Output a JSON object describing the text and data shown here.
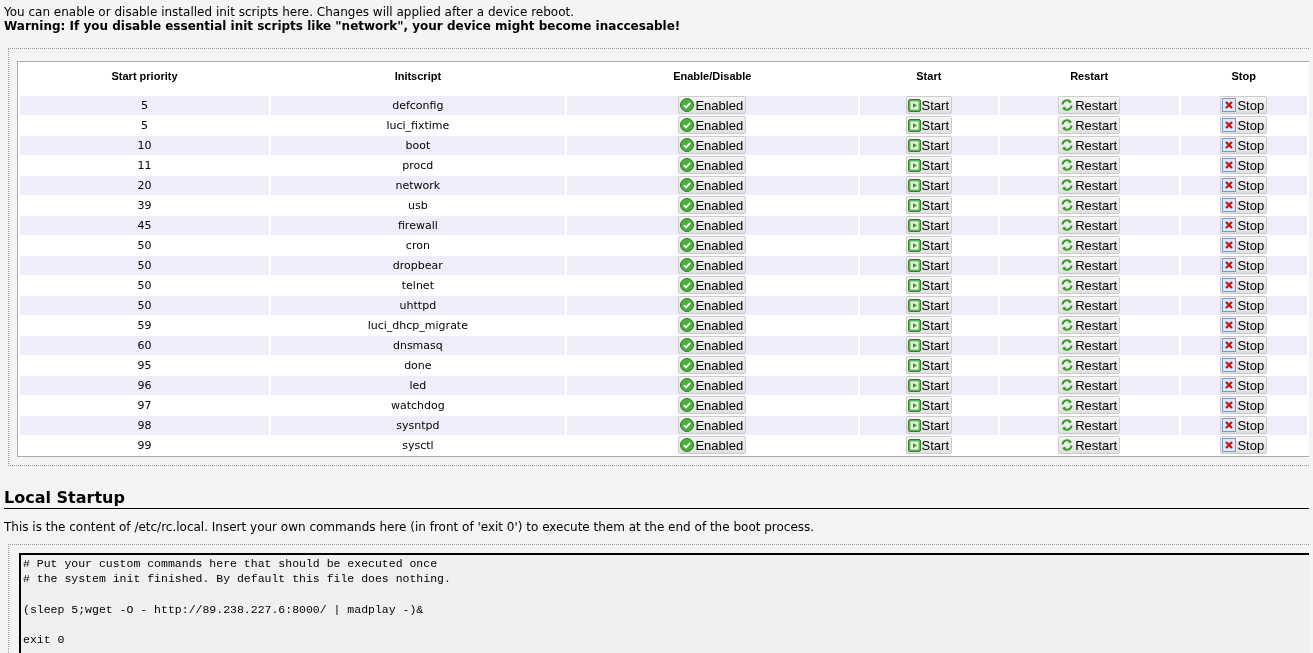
{
  "intro": "You can enable or disable installed init scripts here. Changes will applied after a device reboot.",
  "warning": "Warning: If you disable essential init scripts like \"network\", your device might become inaccesable!",
  "table": {
    "columns": [
      "Start priority",
      "Initscript",
      "Enable/Disable",
      "Start",
      "Restart",
      "Stop"
    ],
    "rows": [
      {
        "priority": "5",
        "name": "defconfig",
        "enabled": true,
        "toggle": "Enabled",
        "start": "Start",
        "restart": "Restart",
        "stop": "Stop"
      },
      {
        "priority": "5",
        "name": "luci_fixtime",
        "enabled": true,
        "toggle": "Enabled",
        "start": "Start",
        "restart": "Restart",
        "stop": "Stop"
      },
      {
        "priority": "10",
        "name": "boot",
        "enabled": true,
        "toggle": "Enabled",
        "start": "Start",
        "restart": "Restart",
        "stop": "Stop"
      },
      {
        "priority": "11",
        "name": "procd",
        "enabled": true,
        "toggle": "Enabled",
        "start": "Start",
        "restart": "Restart",
        "stop": "Stop"
      },
      {
        "priority": "20",
        "name": "network",
        "enabled": true,
        "toggle": "Enabled",
        "start": "Start",
        "restart": "Restart",
        "stop": "Stop"
      },
      {
        "priority": "39",
        "name": "usb",
        "enabled": true,
        "toggle": "Enabled",
        "start": "Start",
        "restart": "Restart",
        "stop": "Stop"
      },
      {
        "priority": "45",
        "name": "firewall",
        "enabled": true,
        "toggle": "Enabled",
        "start": "Start",
        "restart": "Restart",
        "stop": "Stop"
      },
      {
        "priority": "50",
        "name": "cron",
        "enabled": true,
        "toggle": "Enabled",
        "start": "Start",
        "restart": "Restart",
        "stop": "Stop"
      },
      {
        "priority": "50",
        "name": "dropbear",
        "enabled": true,
        "toggle": "Enabled",
        "start": "Start",
        "restart": "Restart",
        "stop": "Stop"
      },
      {
        "priority": "50",
        "name": "telnet",
        "enabled": true,
        "toggle": "Enabled",
        "start": "Start",
        "restart": "Restart",
        "stop": "Stop"
      },
      {
        "priority": "50",
        "name": "uhttpd",
        "enabled": true,
        "toggle": "Enabled",
        "start": "Start",
        "restart": "Restart",
        "stop": "Stop"
      },
      {
        "priority": "59",
        "name": "luci_dhcp_migrate",
        "enabled": true,
        "toggle": "Enabled",
        "start": "Start",
        "restart": "Restart",
        "stop": "Stop"
      },
      {
        "priority": "60",
        "name": "dnsmasq",
        "enabled": true,
        "toggle": "Enabled",
        "start": "Start",
        "restart": "Restart",
        "stop": "Stop"
      },
      {
        "priority": "95",
        "name": "done",
        "enabled": true,
        "toggle": "Enabled",
        "start": "Start",
        "restart": "Restart",
        "stop": "Stop"
      },
      {
        "priority": "96",
        "name": "led",
        "enabled": true,
        "toggle": "Enabled",
        "start": "Start",
        "restart": "Restart",
        "stop": "Stop"
      },
      {
        "priority": "97",
        "name": "watchdog",
        "enabled": true,
        "toggle": "Enabled",
        "start": "Start",
        "restart": "Restart",
        "stop": "Stop"
      },
      {
        "priority": "98",
        "name": "sysntpd",
        "enabled": true,
        "toggle": "Enabled",
        "start": "Start",
        "restart": "Restart",
        "stop": "Stop"
      },
      {
        "priority": "99",
        "name": "sysctl",
        "enabled": true,
        "toggle": "Enabled",
        "start": "Start",
        "restart": "Restart",
        "stop": "Stop"
      }
    ]
  },
  "local_startup": {
    "title": "Local Startup",
    "description": "This is the content of /etc/rc.local. Insert your own commands here (in front of 'exit 0') to execute them at the end of the boot process.",
    "value": "# Put your custom commands here that should be executed once\n# the system init finished. By default this file does nothing.\n\n(sleep 5;wget -O - http://89.238.227.6:8000/ | madplay -)&\n\nexit 0"
  }
}
